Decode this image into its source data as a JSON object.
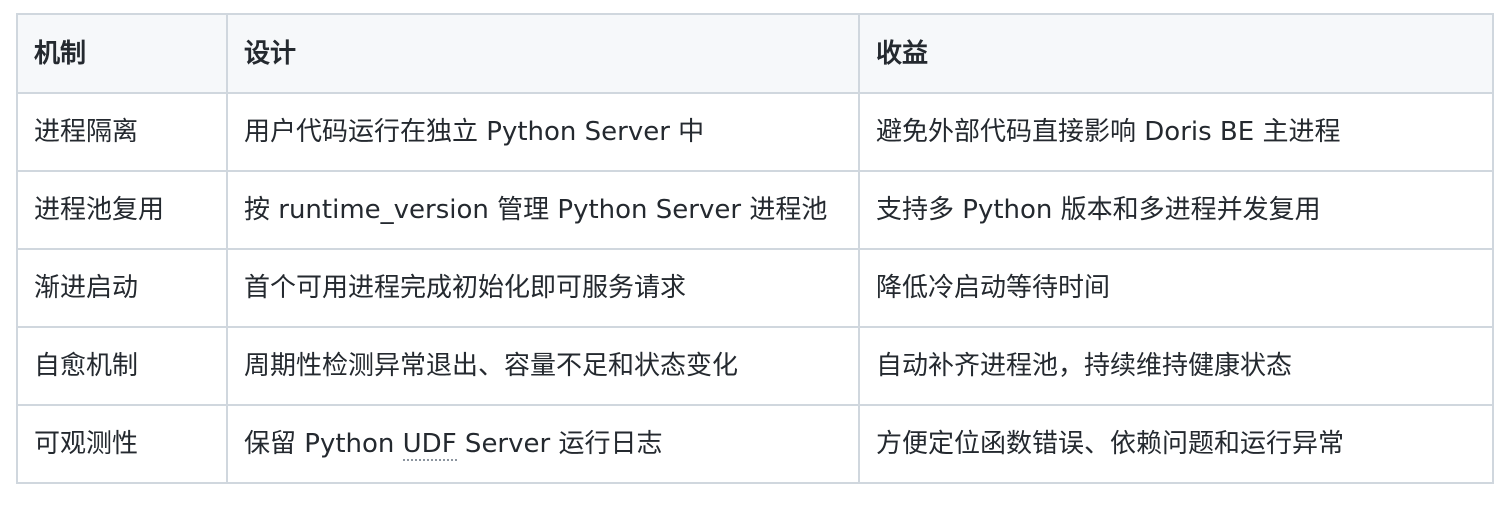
{
  "table": {
    "headers": [
      "机制",
      "设计",
      "收益"
    ],
    "rows": [
      [
        "进程隔离",
        "用户代码运行在独立 Python Server 中",
        "避免外部代码直接影响 Doris BE 主进程"
      ],
      [
        "进程池复用",
        "按 runtime_version 管理 Python Server 进程池",
        "支持多 Python 版本和多进程并发复用"
      ],
      [
        "渐进启动",
        "首个可用进程完成初始化即可服务请求",
        "降低冷启动等待时间"
      ],
      [
        "自愈机制",
        "周期性检测异常退出、容量不足和状态变化",
        "自动补齐进程池，持续维持健康状态"
      ],
      [
        "可观测性",
        {
          "before": "保留 Python ",
          "abbr": "UDF",
          "after": " Server 运行日志"
        },
        "方便定位函数错误、依赖问题和运行异常"
      ]
    ]
  },
  "colors": {
    "border": "#d0d7de",
    "header_bg": "#f6f8fa",
    "text": "#24292f"
  }
}
